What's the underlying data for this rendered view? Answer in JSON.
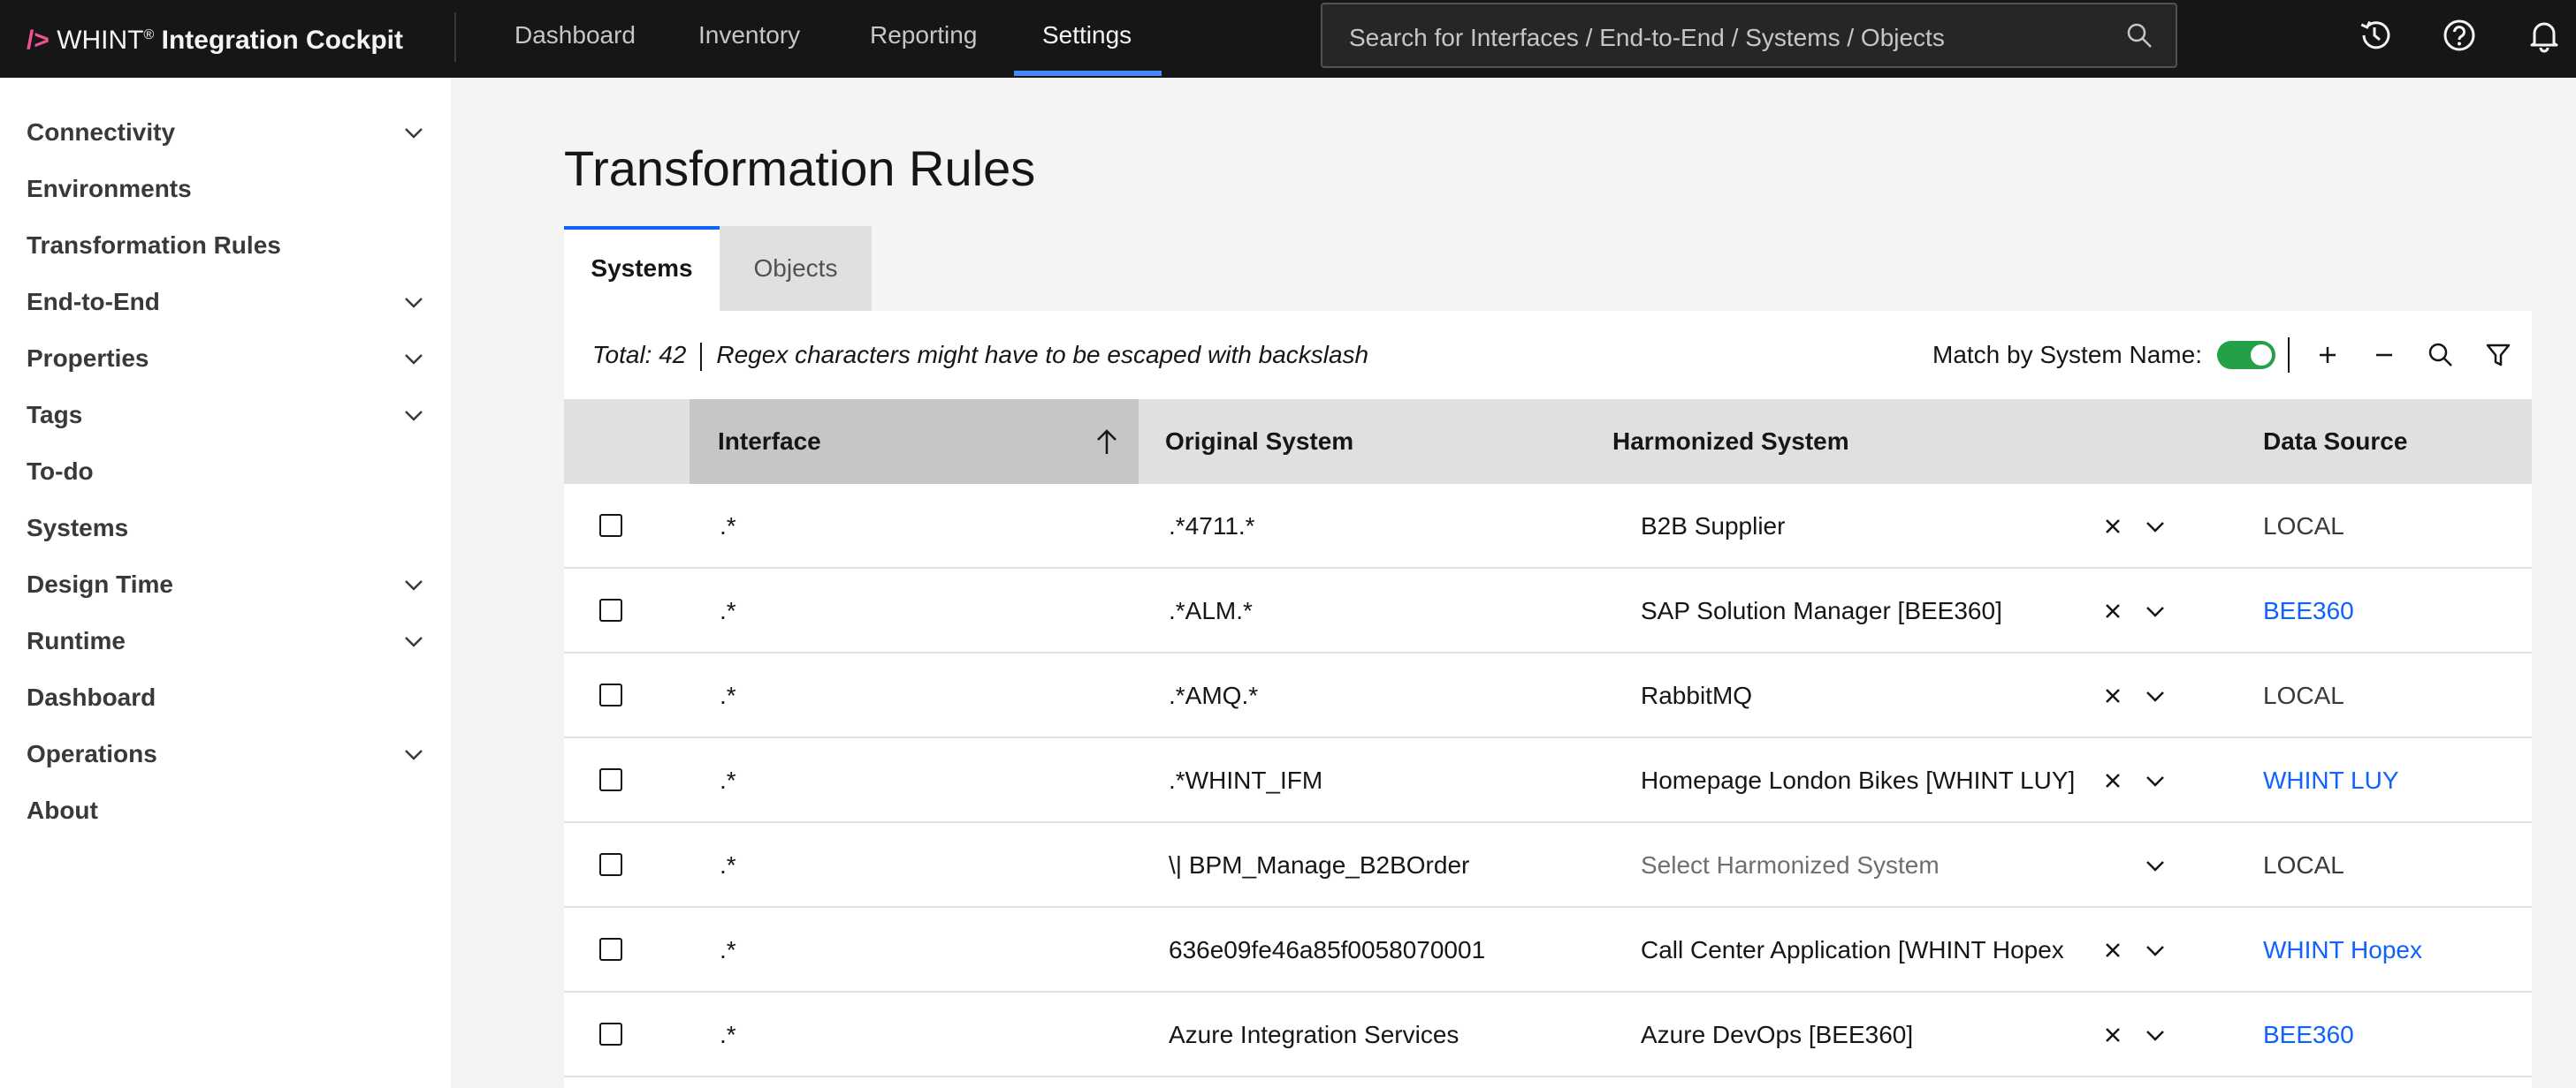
{
  "app": {
    "brand_slash": "/>",
    "brand_name": "WHINT",
    "brand_mark": "®",
    "brand_product": " Integration Cockpit"
  },
  "nav": {
    "items": [
      {
        "label": "Dashboard"
      },
      {
        "label": "Inventory"
      },
      {
        "label": "Reporting"
      },
      {
        "label": "Settings",
        "active": true
      }
    ]
  },
  "search": {
    "placeholder": "Search for Interfaces / End-to-End / Systems / Objects",
    "icon": "search-icon"
  },
  "header_icons": [
    "history-icon",
    "help-icon",
    "notification-icon"
  ],
  "sidebar": {
    "items": [
      {
        "label": "Connectivity",
        "expandable": true
      },
      {
        "label": "Environments",
        "expandable": false
      },
      {
        "label": "Transformation Rules",
        "expandable": false
      },
      {
        "label": "End-to-End",
        "expandable": true
      },
      {
        "label": "Properties",
        "expandable": true
      },
      {
        "label": "Tags",
        "expandable": true
      },
      {
        "label": "To-do",
        "expandable": false
      },
      {
        "label": "Systems",
        "expandable": false
      },
      {
        "label": "Design Time",
        "expandable": true
      },
      {
        "label": "Runtime",
        "expandable": true
      },
      {
        "label": "Dashboard",
        "expandable": false
      },
      {
        "label": "Operations",
        "expandable": true
      },
      {
        "label": "About",
        "expandable": false
      }
    ]
  },
  "page": {
    "title": "Transformation Rules",
    "tabs": [
      {
        "label": "Systems",
        "selected": true
      },
      {
        "label": "Objects",
        "selected": false
      }
    ]
  },
  "toolbar": {
    "total": "Total: 42",
    "hint": "Regex characters might have to be escaped with backslash",
    "match_label": "Match by System Name:",
    "match_enabled": true,
    "buttons": [
      "add-icon",
      "remove-icon",
      "search-icon",
      "filter-icon"
    ]
  },
  "table": {
    "columns": [
      "Interface",
      "Original System",
      "Harmonized System",
      "Data Source"
    ],
    "sort": {
      "column": "Interface",
      "direction": "ascending"
    },
    "rows": [
      {
        "interface": ".*",
        "original": ".*4711.*",
        "harmonized": "B2B Supplier",
        "source": "LOCAL",
        "source_link": false,
        "has_value": true
      },
      {
        "interface": ".*",
        "original": ".*ALM.*",
        "harmonized": "SAP Solution Manager [BEE360]",
        "source": "BEE360",
        "source_link": true,
        "has_value": true
      },
      {
        "interface": ".*",
        "original": ".*AMQ.*",
        "harmonized": "RabbitMQ",
        "source": "LOCAL",
        "source_link": false,
        "has_value": true
      },
      {
        "interface": ".*",
        "original": ".*WHINT_IFM",
        "harmonized": "Homepage London Bikes [WHINT LUY]",
        "source": "WHINT LUY",
        "source_link": true,
        "has_value": true
      },
      {
        "interface": ".*",
        "original": "\\| BPM_Manage_B2BOrder",
        "harmonized": "Select Harmonized System",
        "source": "LOCAL",
        "source_link": false,
        "has_value": false
      },
      {
        "interface": ".*",
        "original": "636e09fe46a85f0058070001",
        "harmonized": "Call Center Application [WHINT Hopex",
        "source": "WHINT Hopex",
        "source_link": true,
        "has_value": true
      },
      {
        "interface": ".*",
        "original": "Azure Integration Services",
        "harmonized": "Azure DevOps [BEE360]",
        "source": "BEE360",
        "source_link": true,
        "has_value": true
      }
    ]
  },
  "colors": {
    "topbar": "#161616",
    "accent": "#0f62fe",
    "nav_underline": "#4589ff",
    "toggle_on": "#24a148",
    "brand_slash": "#ee5396"
  }
}
